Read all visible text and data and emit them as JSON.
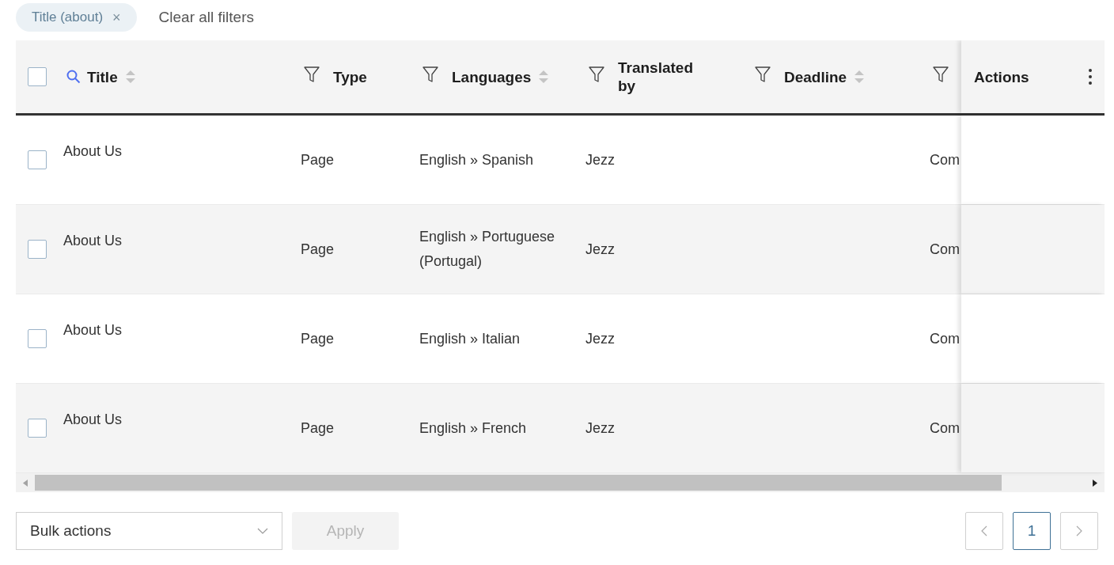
{
  "filters": [
    {
      "label": "Title (about)",
      "remove": "×"
    }
  ],
  "clear_filters": "Clear all filters",
  "table": {
    "select_all_checked": false,
    "columns": [
      {
        "label": "Title",
        "kind": "search_sort"
      },
      {
        "label": "Type",
        "kind": "filter"
      },
      {
        "label": "Languages",
        "kind": "filter_sort"
      },
      {
        "label": "Translated by",
        "kind": "filter"
      },
      {
        "label": "Deadline",
        "kind": "filter_sort"
      },
      {
        "kind": "filter"
      },
      {
        "label": "Actions",
        "kind": "actions"
      }
    ],
    "rows": [
      {
        "checked": false,
        "cells": [
          "About Us",
          "Page",
          "English » Spanish",
          "Jezz",
          "",
          "Com",
          ""
        ]
      },
      {
        "checked": false,
        "cells": [
          "About Us",
          "Page",
          "English » Portuguese (Portugal)",
          "Jezz",
          "",
          "Com",
          ""
        ]
      },
      {
        "checked": false,
        "cells": [
          "About Us",
          "Page",
          "English » Italian",
          "Jezz",
          "",
          "Com",
          ""
        ]
      },
      {
        "checked": false,
        "cells": [
          "About Us",
          "Page",
          "English » French",
          "Jezz",
          "",
          "Com",
          ""
        ]
      }
    ]
  },
  "bulk_actions": {
    "value": "Bulk actions"
  },
  "apply_button": {
    "label": "Apply",
    "disabled": true
  },
  "pagination": {
    "pages": [
      {
        "label": "1",
        "selected": true
      }
    ]
  }
}
